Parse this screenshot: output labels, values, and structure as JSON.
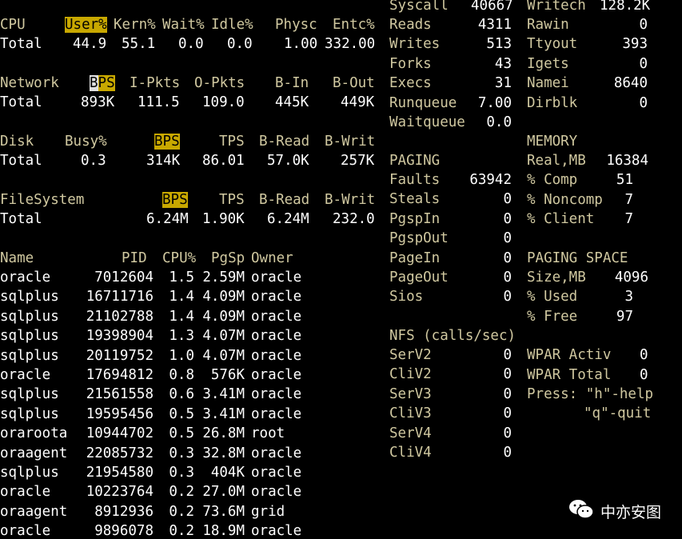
{
  "cpu": {
    "h_label": "CPU",
    "h_user": "User%",
    "h_kern": "Kern%",
    "h_wait": "Wait%",
    "h_idle": "Idle%",
    "h_physc": "Physc",
    "h_entc": "Entc%",
    "label": "Total",
    "user": "44.9",
    "kern": "55.1",
    "wait": "0.0",
    "idle": "0.0",
    "physc": "1.00",
    "entc": "332.00"
  },
  "network": {
    "h_label": "Network",
    "h_bps_a": "B",
    "h_bps_b": "PS",
    "h_ipkts": "I-Pkts",
    "h_opkts": "O-Pkts",
    "h_bin": "B-In",
    "h_bout": "B-Out",
    "label": "Total",
    "bps": "893K",
    "ipkts": "111.5",
    "opkts": "109.0",
    "bin": "445K",
    "bout": "449K"
  },
  "disk": {
    "h_label": "Disk",
    "h_busy": "Busy%",
    "h_bps": "BPS",
    "h_tps": "TPS",
    "h_bread": "B-Read",
    "h_bwrit": "B-Writ",
    "label": "Total",
    "busy": "0.3",
    "bps": "314K",
    "tps": "86.01",
    "bread": "57.0K",
    "bwrit": "257K"
  },
  "filesystem": {
    "h_label": "FileSystem",
    "h_bps": "BPS",
    "h_tps": "TPS",
    "h_bread": "B-Read",
    "h_bwrit": "B-Writ",
    "label": "Total",
    "bps": "6.24M",
    "tps": "1.90K",
    "bread": "6.24M",
    "bwrit": "232.0"
  },
  "process": {
    "h_name": "Name",
    "h_pid": "PID",
    "h_cpu": "CPU%",
    "h_pgsp": "PgSp",
    "h_owner": "Owner",
    "rows": [
      {
        "name": "oracle",
        "pid": "7012604",
        "cpu": "1.5",
        "pgsp": "2.59M",
        "owner": "oracle"
      },
      {
        "name": "sqlplus",
        "pid": "16711716",
        "cpu": "1.4",
        "pgsp": "4.09M",
        "owner": "oracle"
      },
      {
        "name": "sqlplus",
        "pid": "21102788",
        "cpu": "1.4",
        "pgsp": "4.09M",
        "owner": "oracle"
      },
      {
        "name": "sqlplus",
        "pid": "19398904",
        "cpu": "1.3",
        "pgsp": "4.07M",
        "owner": "oracle"
      },
      {
        "name": "sqlplus",
        "pid": "20119752",
        "cpu": "1.0",
        "pgsp": "4.07M",
        "owner": "oracle"
      },
      {
        "name": "oracle",
        "pid": "17694812",
        "cpu": "0.8",
        "pgsp": "576K",
        "owner": "oracle"
      },
      {
        "name": "sqlplus",
        "pid": "21561558",
        "cpu": "0.6",
        "pgsp": "3.41M",
        "owner": "oracle"
      },
      {
        "name": "sqlplus",
        "pid": "19595456",
        "cpu": "0.5",
        "pgsp": "3.41M",
        "owner": "oracle"
      },
      {
        "name": "oraroota",
        "pid": "10944702",
        "cpu": "0.5",
        "pgsp": "26.8M",
        "owner": "root"
      },
      {
        "name": "oraagent",
        "pid": "22085732",
        "cpu": "0.3",
        "pgsp": "32.8M",
        "owner": "oracle"
      },
      {
        "name": "sqlplus",
        "pid": "21954580",
        "cpu": "0.3",
        "pgsp": "404K",
        "owner": "oracle"
      },
      {
        "name": "oracle",
        "pid": "10223764",
        "cpu": "0.2",
        "pgsp": "27.0M",
        "owner": "oracle"
      },
      {
        "name": "oraagent",
        "pid": "8912936",
        "cpu": "0.2",
        "pgsp": "73.6M",
        "owner": "grid"
      },
      {
        "name": "oracle",
        "pid": "9896078",
        "cpu": "0.2",
        "pgsp": "18.9M",
        "owner": "oracle"
      }
    ]
  },
  "sys": {
    "syscall_label": "Syscall",
    "syscall": "40667",
    "writech_label": "Writech",
    "writech": "128.2K",
    "rows_left": [
      {
        "label": "Reads",
        "value": "4311"
      },
      {
        "label": "Writes",
        "value": "513"
      },
      {
        "label": "Forks",
        "value": "43"
      },
      {
        "label": "Execs",
        "value": "31"
      },
      {
        "label": "Runqueue",
        "value": "7.00"
      },
      {
        "label": "Waitqueue",
        "value": "0.0"
      }
    ],
    "rows_right": [
      {
        "label": "Rawin",
        "value": "0"
      },
      {
        "label": "Ttyout",
        "value": "393"
      },
      {
        "label": "Igets",
        "value": "0"
      },
      {
        "label": "Namei",
        "value": "8640"
      },
      {
        "label": "Dirblk",
        "value": "0"
      }
    ]
  },
  "paging": {
    "title": "PAGING",
    "rows": [
      {
        "label": "Faults",
        "value": "63942"
      },
      {
        "label": "Steals",
        "value": "0"
      },
      {
        "label": "PgspIn",
        "value": "0"
      },
      {
        "label": "PgspOut",
        "value": "0"
      },
      {
        "label": "PageIn",
        "value": "0"
      },
      {
        "label": "PageOut",
        "value": "0"
      },
      {
        "label": "Sios",
        "value": "0"
      }
    ]
  },
  "nfs": {
    "title": "NFS (calls/sec)",
    "rows": [
      {
        "label": "SerV2",
        "value": "0"
      },
      {
        "label": "CliV2",
        "value": "0"
      },
      {
        "label": "SerV3",
        "value": "0"
      },
      {
        "label": "CliV3",
        "value": "0"
      },
      {
        "label": "SerV4",
        "value": "0"
      },
      {
        "label": "CliV4",
        "value": "0"
      }
    ]
  },
  "memory": {
    "title": "MEMORY",
    "rows": [
      {
        "label": "Real,MB",
        "value": "16384"
      },
      {
        "label": "% Comp",
        "value": "51"
      },
      {
        "label": "% Noncomp",
        "value": "7"
      },
      {
        "label": "% Client",
        "value": "7"
      }
    ]
  },
  "paging_space": {
    "title": "PAGING SPACE",
    "rows": [
      {
        "label": "Size,MB",
        "value": "4096"
      },
      {
        "label": "% Used",
        "value": "3"
      },
      {
        "label": "% Free",
        "value": "97"
      }
    ]
  },
  "wpar": {
    "activ_label": "WPAR Activ",
    "activ": "0",
    "total_label": "WPAR Total",
    "total": "0",
    "help": "Press: \"h\"-help",
    "quit": "\"q\"-quit"
  },
  "watermark": {
    "text": "中亦安图",
    "icon": "wechat-icon"
  },
  "colors": {
    "header": "#d0c8a0",
    "highlight": "#c8a800",
    "text": "#ffffff",
    "background": "#000000"
  }
}
